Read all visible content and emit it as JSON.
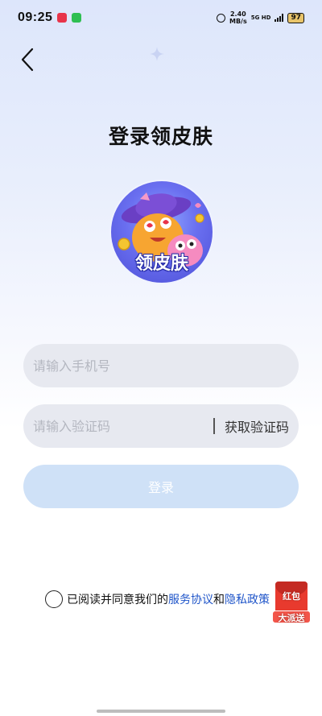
{
  "status_bar": {
    "time": "09:25",
    "speed_value": "2.40",
    "speed_unit": "MB/s",
    "network": "5G HD",
    "battery": "97"
  },
  "header": {
    "title": "登录领皮肤"
  },
  "logo": {
    "label": "领皮肤"
  },
  "form": {
    "phone_placeholder": "请输入手机号",
    "phone_value": "",
    "code_placeholder": "请输入验证码",
    "code_value": "",
    "get_code_label": "获取验证码",
    "login_label": "登录"
  },
  "agreement": {
    "prefix": "已阅读并同意我们的",
    "service_link": "服务协议",
    "conjunction": "和",
    "privacy_link": "隐私政策",
    "checked": false
  },
  "promo": {
    "line1": "红包",
    "line2": "大派送"
  },
  "colors": {
    "accent_link": "#1f55c9",
    "login_button_disabled": "#cfe1f7",
    "field_background": "#e7e9f0"
  },
  "icons": {
    "back": "chevron-left-icon",
    "sparkle": "sparkle-icon",
    "alarm": "alarm-clock-icon",
    "signal": "signal-icon",
    "battery": "battery-icon"
  }
}
